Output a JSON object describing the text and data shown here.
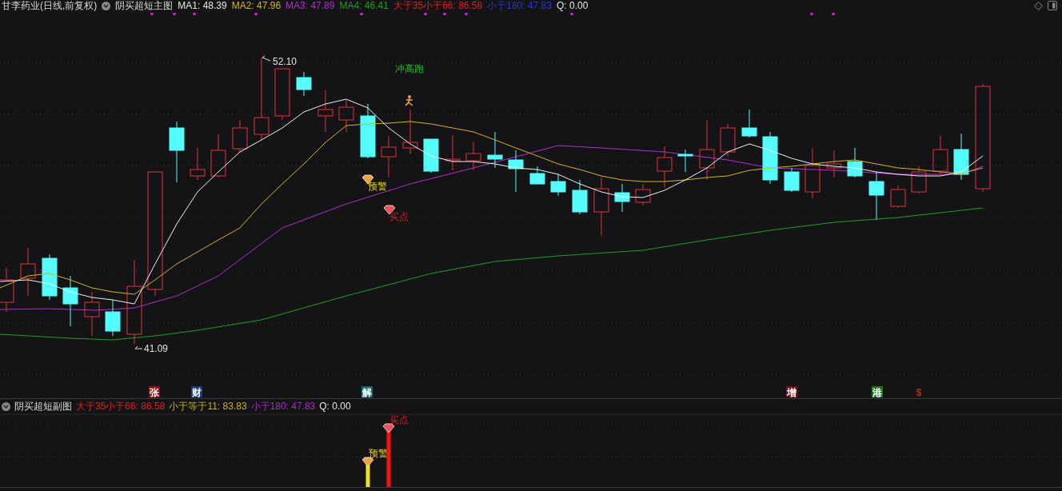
{
  "main_chart": {
    "title": "甘李药业(日线,前复权)",
    "indicator": "阴买超短主图",
    "legend": [
      {
        "label": "MA1: 48.39",
        "color": "#e6e6e6"
      },
      {
        "label": "MA2: 47.96",
        "color": "#d4b418"
      },
      {
        "label": "MA3: 47.89",
        "color": "#b42cd0"
      },
      {
        "label": "MA4: 46.41",
        "color": "#1ea01e"
      },
      {
        "label": "大于35小于66: 86.58",
        "color": "#e02020"
      },
      {
        "label": "小于180: 47.83",
        "color": "#2838d8"
      },
      {
        "label": "Q: 0.00",
        "color": "#e6e6e6"
      }
    ],
    "high_label": "52.10",
    "low_label": "41.09",
    "signals": [
      {
        "label": "冲高跑",
        "kind": "run"
      },
      {
        "label": "预警",
        "kind": "warning"
      },
      {
        "label": "买点",
        "kind": "buy"
      }
    ]
  },
  "events": [
    {
      "label": "张",
      "kind": "tag",
      "color": "#8a1010"
    },
    {
      "label": "财",
      "kind": "tag",
      "color": "#1a3f72"
    },
    {
      "label": "解",
      "kind": "tag",
      "color": "#0f7070"
    },
    {
      "label": "增",
      "kind": "tag",
      "color": "#7a0e0e"
    },
    {
      "label": "港",
      "kind": "tag",
      "color": "#157a15"
    },
    {
      "label": "$",
      "kind": "plain",
      "color": "#d42020"
    }
  ],
  "sub_chart": {
    "indicator": "阴买超短副图",
    "legend": [
      {
        "label": "大于35小于66: 86.58",
        "color": "#e02020"
      },
      {
        "label": "小于等于11: 83.83",
        "color": "#c8b020"
      },
      {
        "label": "小于180: 47.83",
        "color": "#a030c0"
      },
      {
        "label": "Q: 0.00",
        "color": "#e6e6e6"
      }
    ],
    "bars": [
      {
        "label": "预警",
        "kind": "warning"
      },
      {
        "label": "买点",
        "kind": "buy"
      }
    ]
  }
}
